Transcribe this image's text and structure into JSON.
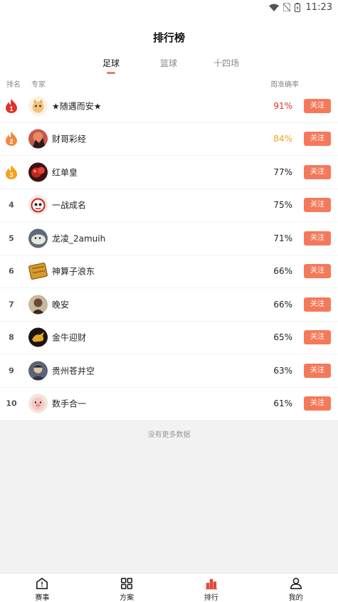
{
  "status": {
    "time": "11:23"
  },
  "title": "排行榜",
  "tabs": [
    {
      "label": "足球",
      "active": true
    },
    {
      "label": "篮球",
      "active": false
    },
    {
      "label": "十四场",
      "active": false
    }
  ],
  "columns": {
    "rank": "排名",
    "expert": "专家",
    "rate": "周准确率"
  },
  "follow_label": "关注",
  "rows": [
    {
      "rank": "1",
      "name": "★随遇而安★",
      "rate": "91%"
    },
    {
      "rank": "2",
      "name": "财哥彩经",
      "rate": "84%"
    },
    {
      "rank": "3",
      "name": "红单皇",
      "rate": "77%"
    },
    {
      "rank": "4",
      "name": "一战成名",
      "rate": "75%"
    },
    {
      "rank": "5",
      "name": "龙凌_2amuih",
      "rate": "71%"
    },
    {
      "rank": "6",
      "name": "神算子浪东",
      "rate": "66%"
    },
    {
      "rank": "7",
      "name": "晚安",
      "rate": "66%"
    },
    {
      "rank": "8",
      "name": "金牛迎财",
      "rate": "65%"
    },
    {
      "rank": "9",
      "name": "贵州苍井空",
      "rate": "63%"
    },
    {
      "rank": "10",
      "name": "数手合一",
      "rate": "61%"
    }
  ],
  "no_more": "没有更多数据",
  "nav": [
    {
      "label": "赛事",
      "icon": "home-icon"
    },
    {
      "label": "方案",
      "icon": "grid-icon"
    },
    {
      "label": "排行",
      "icon": "bar-chart-icon"
    },
    {
      "label": "我的",
      "icon": "user-icon"
    }
  ],
  "colors": {
    "accent": "#f4795b",
    "rank1": "#e0312b",
    "rank2": "#f3a21b"
  }
}
